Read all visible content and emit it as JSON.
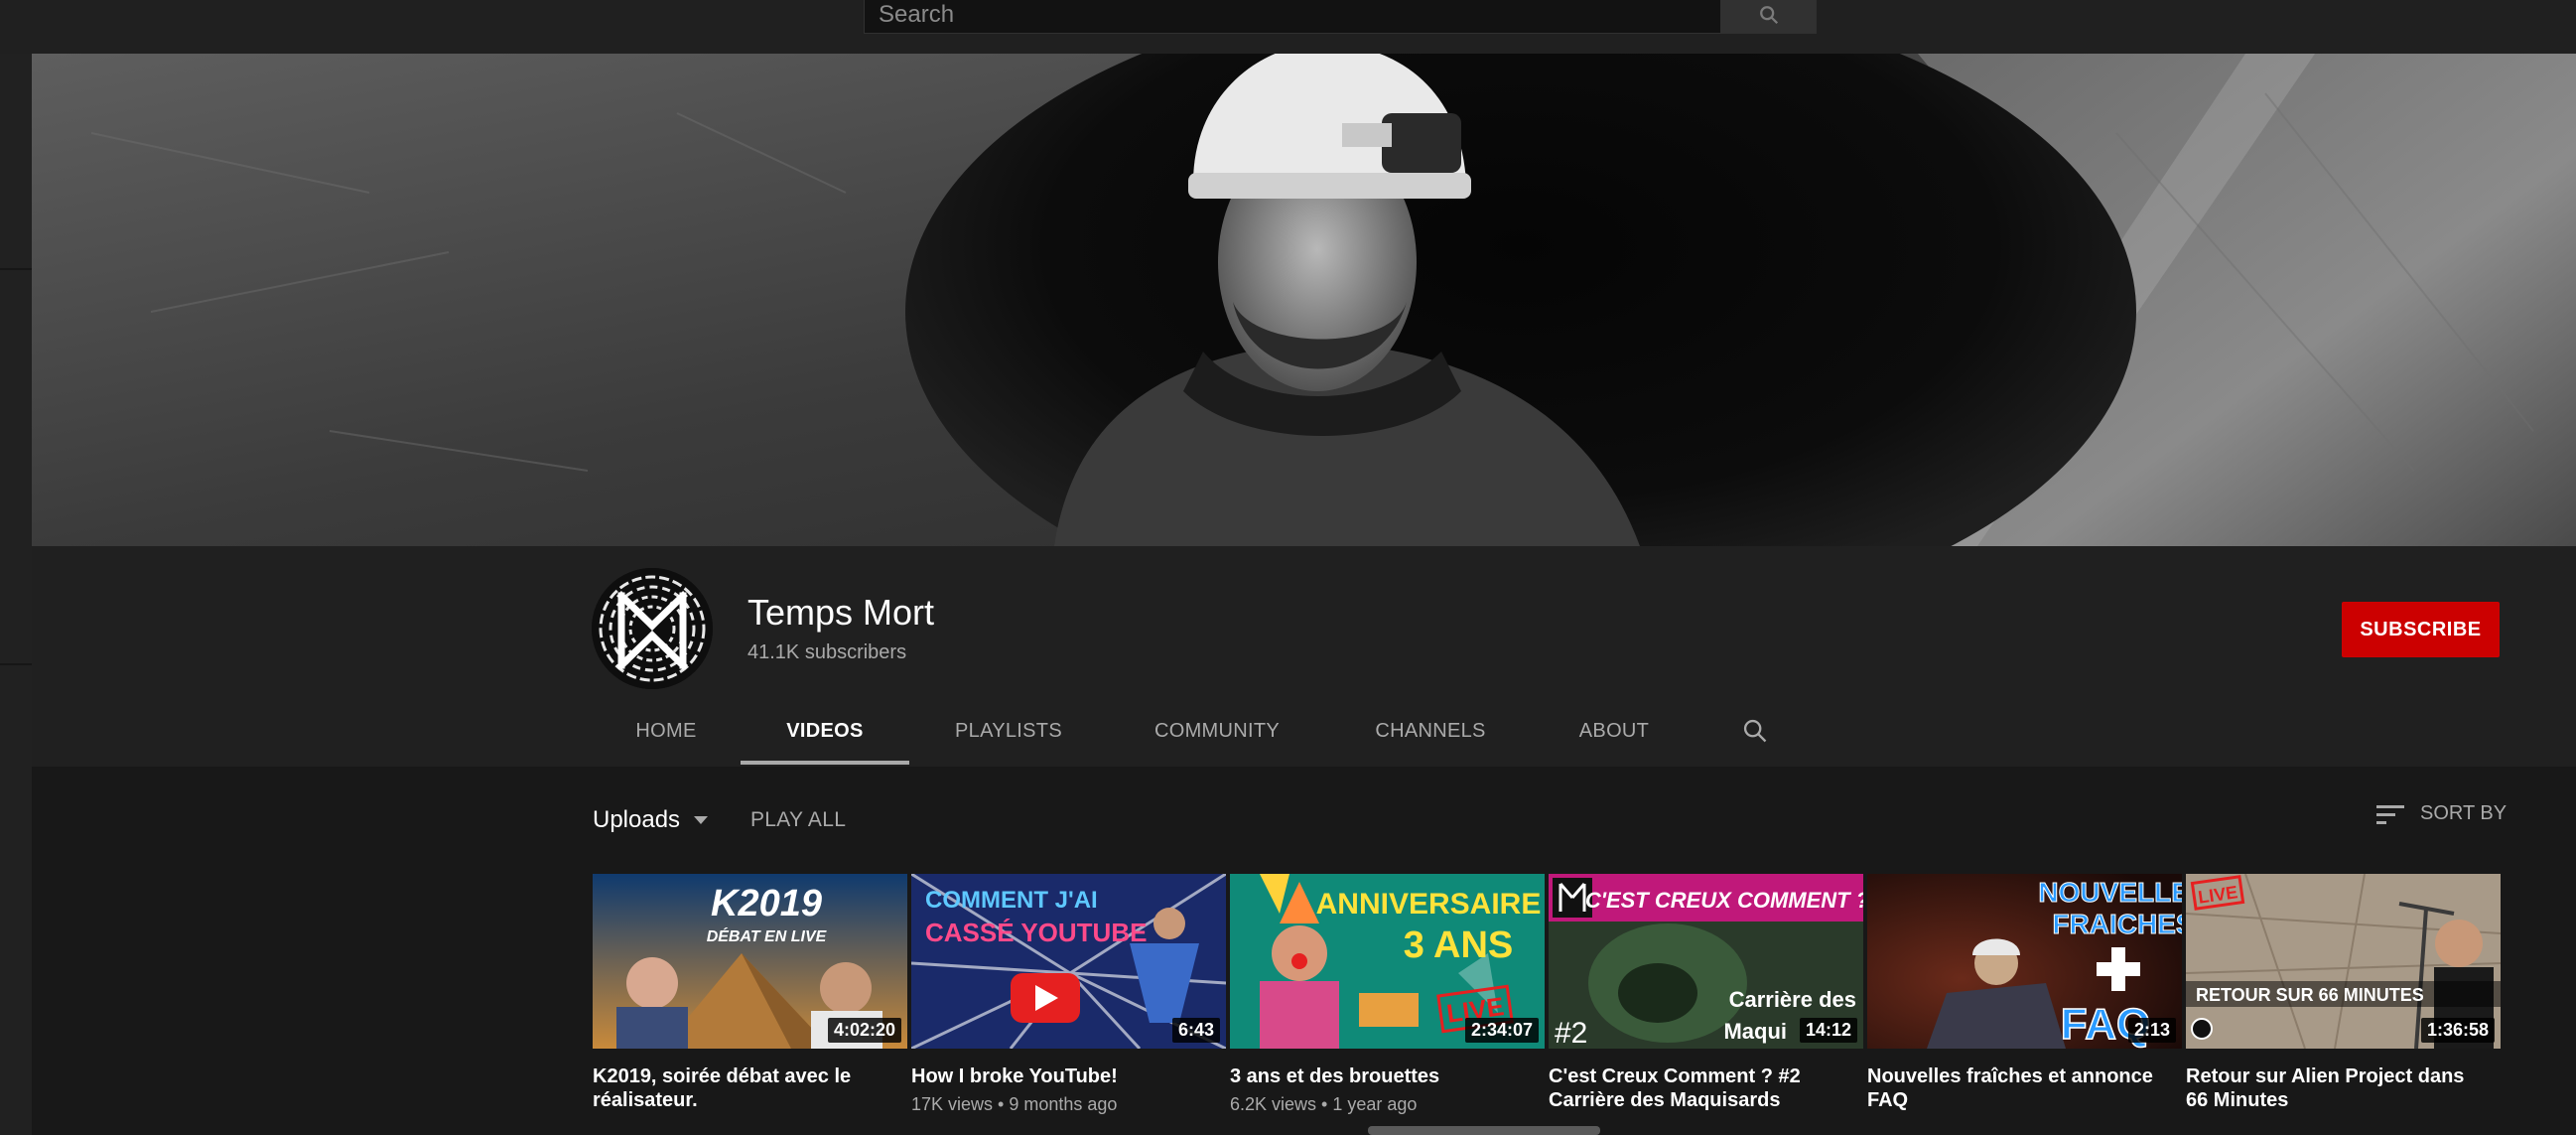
{
  "search": {
    "placeholder": "Search"
  },
  "channel": {
    "name": "Temps Mort",
    "subscribers": "41.1K subscribers",
    "subscribe_label": "SUBSCRIBE"
  },
  "tabs": [
    {
      "label": "HOME"
    },
    {
      "label": "VIDEOS"
    },
    {
      "label": "PLAYLISTS"
    },
    {
      "label": "COMMUNITY"
    },
    {
      "label": "CHANNELS"
    },
    {
      "label": "ABOUT"
    }
  ],
  "active_tab": "VIDEOS",
  "section": {
    "uploads_label": "Uploads",
    "play_all_label": "PLAY ALL",
    "sort_label": "SORT BY"
  },
  "videos": [
    {
      "title": "K2019, soirée débat avec le réalisateur.",
      "meta": "",
      "duration": "4:02:20",
      "thumb_text": [
        "K2019",
        "DÉBAT EN LIVE"
      ]
    },
    {
      "title": "How I broke YouTube!",
      "meta": "17K views • 9 months ago",
      "duration": "6:43",
      "thumb_text": [
        "COMMENT J'AI",
        "CASSÉ YOUTUBE"
      ]
    },
    {
      "title": "3 ans et des brouettes",
      "meta": "6.2K views • 1 year ago",
      "duration": "2:34:07",
      "thumb_text": [
        "ANNIVERSAIRE",
        "3 ANS",
        "LIVE"
      ]
    },
    {
      "title": "C'est Creux Comment ? #2 Carrière des Maquisards",
      "meta": "",
      "duration": "14:12",
      "thumb_text": [
        "C'EST CREUX COMMENT ?",
        "Carrière des",
        "Maqui",
        "#2"
      ]
    },
    {
      "title": "Nouvelles fraîches et annonce FAQ",
      "meta": "",
      "duration": "2:13",
      "thumb_text": [
        "NOUVELLES",
        "FRAICHES",
        "FAQ"
      ]
    },
    {
      "title": "Retour sur Alien Project dans 66 Minutes",
      "meta": "",
      "duration": "1:36:58",
      "thumb_text": [
        "LIVE",
        "RETOUR SUR 66 MINUTES"
      ]
    }
  ],
  "colors": {
    "subscribe": "#cc0000",
    "background": "#181818",
    "header": "#202020"
  }
}
